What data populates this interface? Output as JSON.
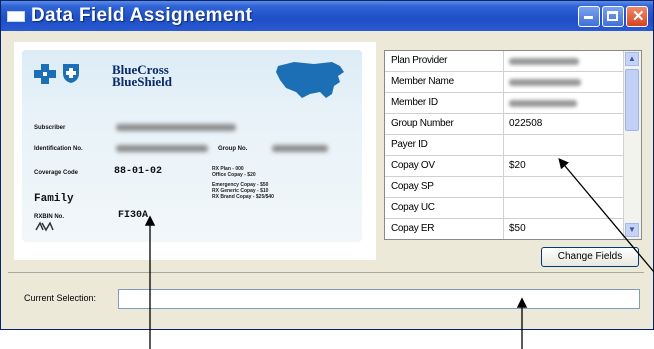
{
  "window": {
    "title": "Data Field Assignement"
  },
  "card": {
    "brand_line1": "BlueCross",
    "brand_line2": "BlueShield",
    "subscriber_label": "Subscriber",
    "identification_label": "Identification No.",
    "group_label": "Group No.",
    "coverage_label": "Coverage Code",
    "coverage_value": "88-01-02",
    "family_text": "Family",
    "rxbin_label": "RXBIN No.",
    "rxbin_value": "FI30A",
    "benefit_lines_1": [
      "RX Plan - 000",
      "Office Copay - $20"
    ],
    "benefit_lines_2": [
      "Emergency Copay - $50",
      "RX Generic Copay - $10",
      "RX Brand Copay - $25/$40"
    ]
  },
  "grid": {
    "rows": [
      {
        "field": "Plan Provider",
        "value": "",
        "blurred": true
      },
      {
        "field": "Member Name",
        "value": "",
        "blurred": true
      },
      {
        "field": "Member ID",
        "value": "",
        "blurred": true
      },
      {
        "field": "Group Number",
        "value": "022508",
        "blurred": false
      },
      {
        "field": "Payer ID",
        "value": "",
        "blurred": false
      },
      {
        "field": "Copay OV",
        "value": "$20",
        "blurred": false
      },
      {
        "field": "Copay SP",
        "value": "",
        "blurred": false
      },
      {
        "field": "Copay UC",
        "value": "",
        "blurred": false
      },
      {
        "field": "Copay ER",
        "value": "$50",
        "blurred": false
      }
    ],
    "scroll_up_icon": "arrow-up-icon",
    "scroll_down_icon": "arrow-down-icon"
  },
  "buttons": {
    "change_fields": "Change Fields"
  },
  "selection": {
    "label": "Current Selection:",
    "value": ""
  },
  "colors": {
    "titlebar": "#2f63d6",
    "window_bg": "#ece9d8",
    "close_button": "#d6431f"
  }
}
